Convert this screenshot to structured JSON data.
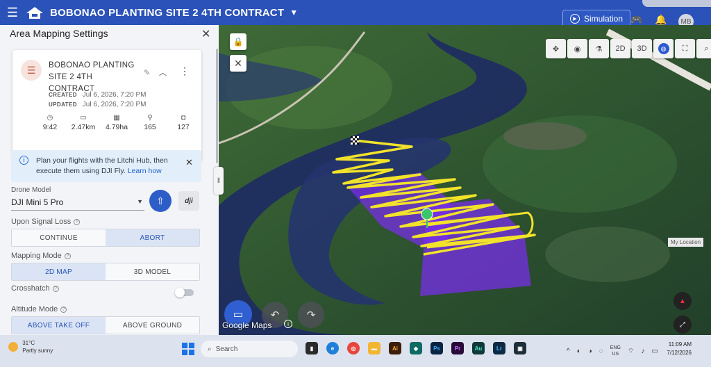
{
  "header": {
    "title": "BOBONAO PLANTING SITE 2 4TH CONTRACT",
    "simulation_label": "Simulation",
    "avatar_initials": "MB"
  },
  "panel": {
    "title": "Area Mapping Settings",
    "mission": {
      "name": "BOBONAO PLANTING SITE 2 4TH CONTRACT",
      "created_label": "CREATED",
      "created_value": "Jul 6, 2026, 7:20 PM",
      "updated_label": "UPDATED",
      "updated_value": "Jul 6, 2026, 7:20 PM",
      "stats": {
        "duration": "9:42",
        "distance": "2.47km",
        "area": "4.79ha",
        "waypoints": "165",
        "photos": "127"
      }
    },
    "info": {
      "text": "Plan your flights with the Litchi Hub, then execute them using DJI Fly.",
      "link": "Learn how"
    },
    "drone_model": {
      "label": "Drone Model",
      "value": "DJI Mini 5 Pro",
      "dji_label": "dji"
    },
    "signal_loss": {
      "label": "Upon Signal Loss",
      "options": [
        "CONTINUE",
        "ABORT"
      ],
      "selected": "ABORT"
    },
    "mapping_mode": {
      "label": "Mapping Mode",
      "options": [
        "2D MAP",
        "3D MODEL"
      ],
      "selected": "2D MAP"
    },
    "crosshatch": {
      "label": "Crosshatch",
      "enabled": false
    },
    "altitude_mode": {
      "label": "Altitude Mode",
      "options": [
        "ABOVE TAKE OFF",
        "ABOVE GROUND"
      ],
      "selected": "ABOVE TAKE OFF"
    }
  },
  "map": {
    "attribution": "Google Maps",
    "my_location_tooltip": "My Location",
    "tools": [
      "move-icon",
      "eye-icon",
      "satellite-icon",
      "2D",
      "3D",
      "globe-icon",
      "fullscreen-icon",
      "search-icon"
    ],
    "colors": {
      "flight_path": "#f2e32a",
      "area_fill": "#7a2cf0",
      "waypoint": "#3ec46d"
    }
  },
  "taskbar": {
    "weather_temp": "31°C",
    "weather_desc": "Partly sunny",
    "search_placeholder": "Search",
    "lang_line1": "ENG",
    "lang_line2": "US",
    "time": "11:09 AM",
    "date": "7/12/2026"
  }
}
